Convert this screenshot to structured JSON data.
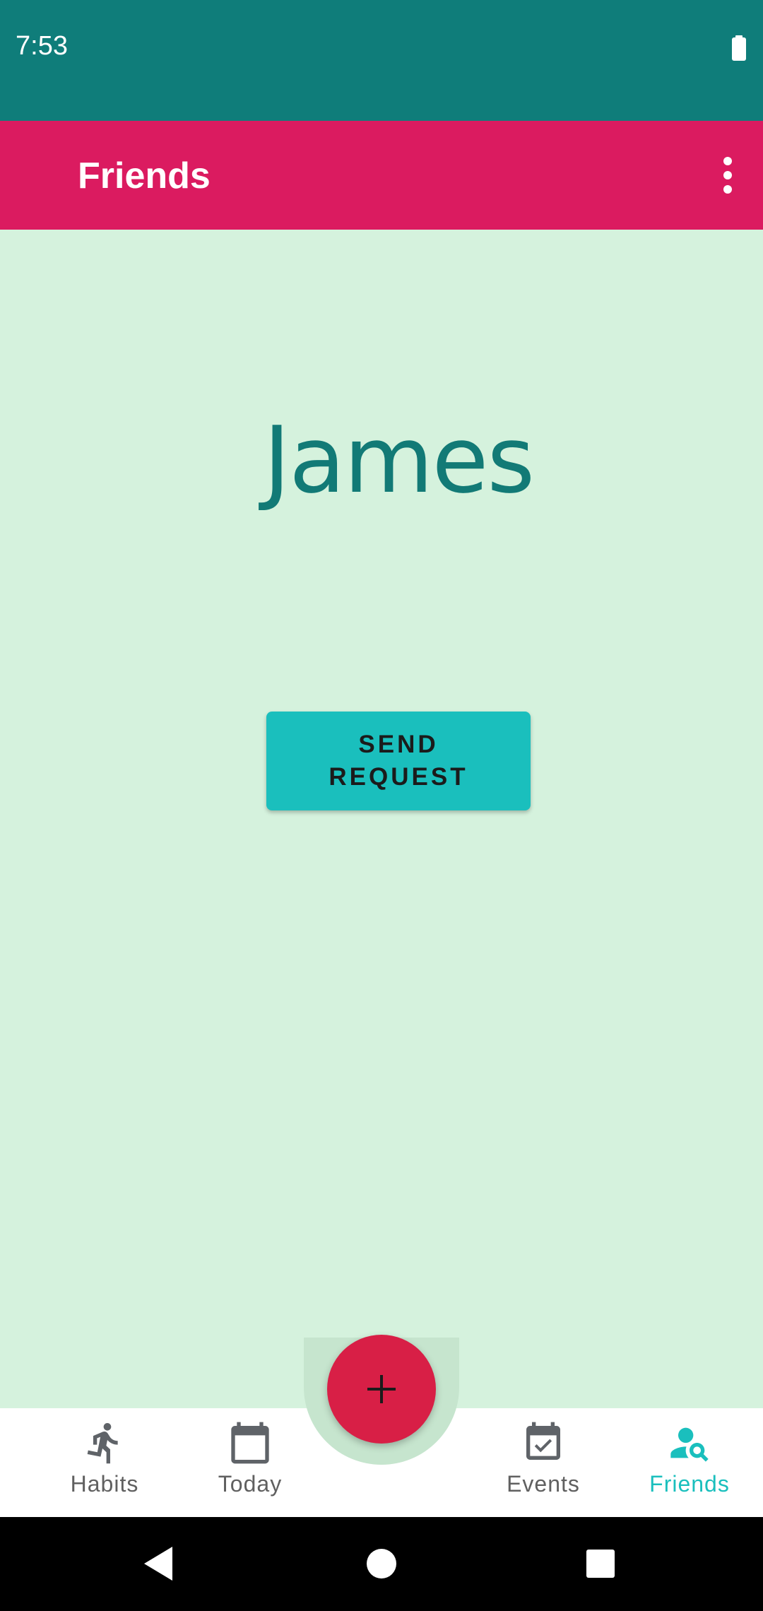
{
  "status_bar": {
    "time": "7:53",
    "battery_icon": "battery-full-icon"
  },
  "app_bar": {
    "title": "Friends",
    "menu_icon": "more-vert-icon"
  },
  "profile": {
    "name": "James",
    "send_request_label": "SEND REQUEST"
  },
  "fab": {
    "icon": "plus-icon"
  },
  "bottom_nav": {
    "items": [
      {
        "label": "Habits",
        "icon": "running-person-icon",
        "active": false
      },
      {
        "label": "Today",
        "icon": "calendar-icon",
        "active": false
      },
      {
        "label": "Events",
        "icon": "calendar-check-icon",
        "active": false
      },
      {
        "label": "Friends",
        "icon": "person-search-icon",
        "active": true
      }
    ]
  },
  "system_nav": {
    "back_icon": "back-triangle-icon",
    "home_icon": "home-circle-icon",
    "recents_icon": "recents-square-icon"
  },
  "colors": {
    "status_bar": "#0f7d7a",
    "app_bar": "#db1b60",
    "background": "#d5f2dd",
    "accent": "#1abfbd",
    "name_text": "#127a76",
    "fab": "#d81f46",
    "nav_inactive": "#606060"
  }
}
